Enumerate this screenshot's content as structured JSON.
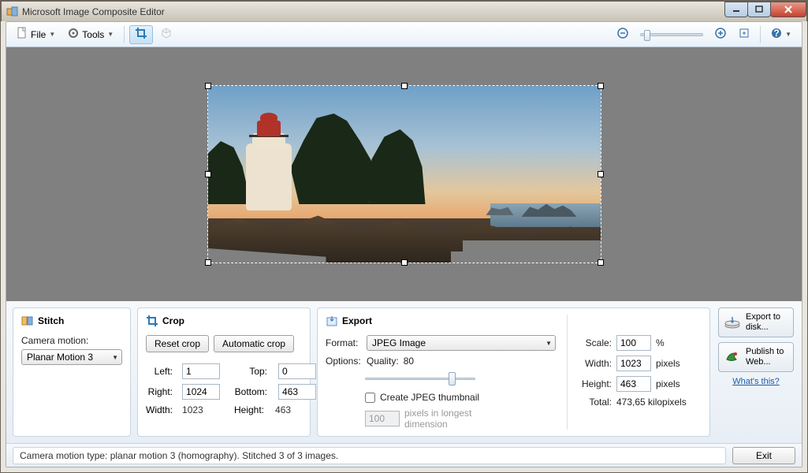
{
  "title": "Microsoft Image Composite Editor",
  "toolbar": {
    "file": "File",
    "tools": "Tools"
  },
  "stitch": {
    "header": "Stitch",
    "camera_motion_label": "Camera motion:",
    "camera_motion_value": "Planar Motion 3"
  },
  "crop": {
    "header": "Crop",
    "reset": "Reset crop",
    "auto": "Automatic crop",
    "left_label": "Left:",
    "left": "1",
    "top_label": "Top:",
    "top": "0",
    "right_label": "Right:",
    "right": "1024",
    "bottom_label": "Bottom:",
    "bottom": "463",
    "width_label": "Width:",
    "width": "1023",
    "height_label": "Height:",
    "height": "463"
  },
  "export": {
    "header": "Export",
    "format_label": "Format:",
    "format_value": "JPEG Image",
    "options_label": "Options:",
    "quality_label": "Quality:",
    "quality_value": "80",
    "thumb_label": "Create JPEG thumbnail",
    "thumb_px": "100",
    "thumb_hint": "pixels in longest dimension",
    "scale_label": "Scale:",
    "scale": "100",
    "scale_unit": "%",
    "width_label": "Width:",
    "width": "1023",
    "px": "pixels",
    "height_label": "Height:",
    "height": "463",
    "total_label": "Total:",
    "total": "473,65 kilopixels"
  },
  "side": {
    "export_disk": "Export to disk...",
    "publish": "Publish to Web...",
    "whats_this": "What's this?"
  },
  "status": "Camera motion type: planar motion 3 (homography). Stitched 3 of 3 images.",
  "exit": "Exit"
}
